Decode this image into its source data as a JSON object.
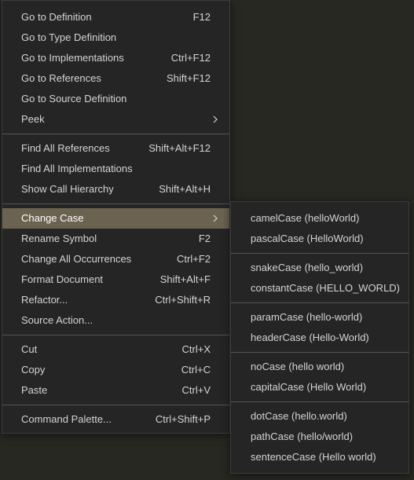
{
  "context_menu": {
    "groups": [
      [
        {
          "label": "Go to Definition",
          "shortcut": "F12"
        },
        {
          "label": "Go to Type Definition",
          "shortcut": ""
        },
        {
          "label": "Go to Implementations",
          "shortcut": "Ctrl+F12"
        },
        {
          "label": "Go to References",
          "shortcut": "Shift+F12"
        },
        {
          "label": "Go to Source Definition",
          "shortcut": ""
        },
        {
          "label": "Peek",
          "shortcut": "",
          "submenu": true
        }
      ],
      [
        {
          "label": "Find All References",
          "shortcut": "Shift+Alt+F12"
        },
        {
          "label": "Find All Implementations",
          "shortcut": ""
        },
        {
          "label": "Show Call Hierarchy",
          "shortcut": "Shift+Alt+H"
        }
      ],
      [
        {
          "label": "Change Case",
          "shortcut": "",
          "submenu": true,
          "active": true
        },
        {
          "label": "Rename Symbol",
          "shortcut": "F2"
        },
        {
          "label": "Change All Occurrences",
          "shortcut": "Ctrl+F2"
        },
        {
          "label": "Format Document",
          "shortcut": "Shift+Alt+F"
        },
        {
          "label": "Refactor...",
          "shortcut": "Ctrl+Shift+R"
        },
        {
          "label": "Source Action...",
          "shortcut": ""
        }
      ],
      [
        {
          "label": "Cut",
          "shortcut": "Ctrl+X"
        },
        {
          "label": "Copy",
          "shortcut": "Ctrl+C"
        },
        {
          "label": "Paste",
          "shortcut": "Ctrl+V"
        }
      ],
      [
        {
          "label": "Command Palette...",
          "shortcut": "Ctrl+Shift+P"
        }
      ]
    ]
  },
  "change_case_submenu": {
    "groups": [
      [
        {
          "label": "camelCase (helloWorld)"
        },
        {
          "label": "pascalCase (HelloWorld)"
        }
      ],
      [
        {
          "label": "snakeCase (hello_world)"
        },
        {
          "label": "constantCase (HELLO_WORLD)"
        }
      ],
      [
        {
          "label": "paramCase (hello-world)"
        },
        {
          "label": "headerCase (Hello-World)"
        }
      ],
      [
        {
          "label": "noCase (hello world)"
        },
        {
          "label": "capitalCase (Hello World)"
        }
      ],
      [
        {
          "label": "dotCase (hello.world)"
        },
        {
          "label": "pathCase (hello/world)"
        },
        {
          "label": "sentenceCase (Hello world)"
        }
      ]
    ]
  },
  "icons": {
    "submenu_arrow": "chevron-right-icon"
  },
  "colors": {
    "menu_background": "#252526",
    "active_item": "#6b6350",
    "editor_background": "#272822",
    "separator": "#555555",
    "text": "#d4d4d4"
  }
}
